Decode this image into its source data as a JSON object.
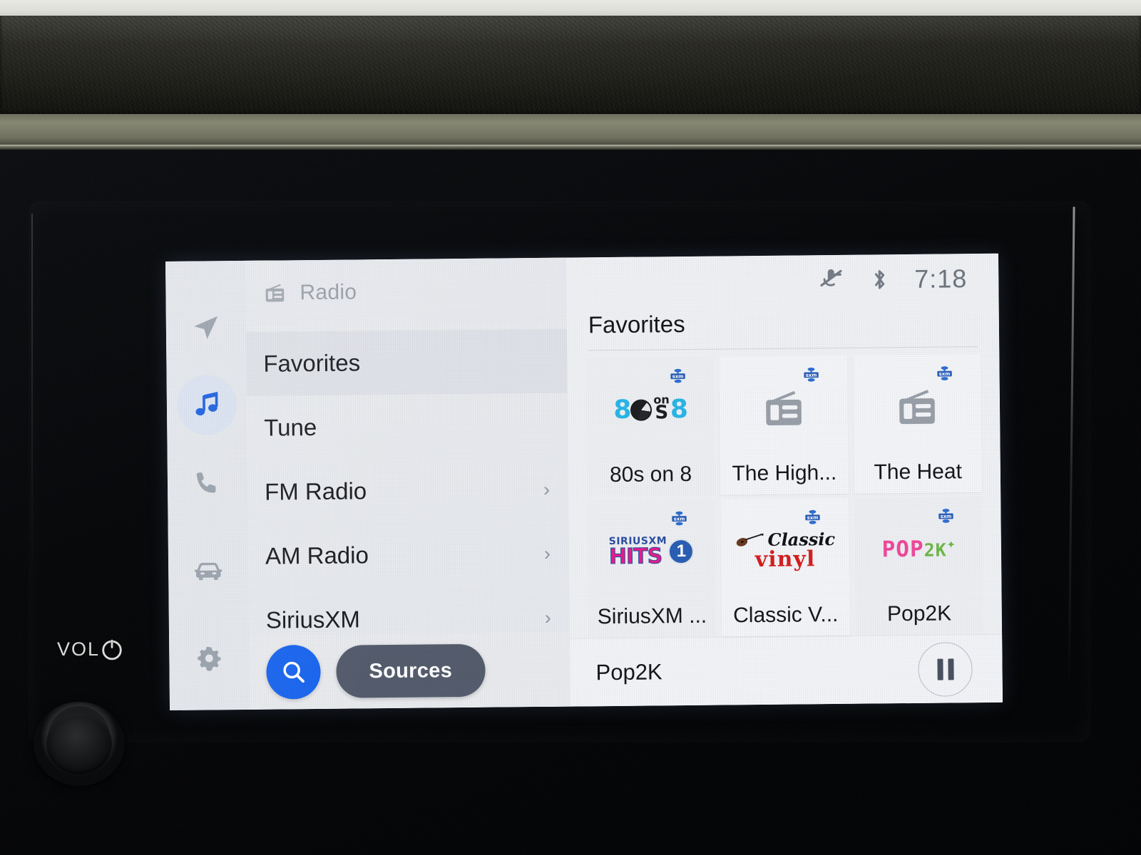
{
  "car_panel": {
    "vol_label": "VOL",
    "power_icon": "power-icon",
    "knob": "volume-knob"
  },
  "rail": {
    "items": [
      {
        "icon": "navigation-arrow-icon",
        "name": "navigation",
        "active": false
      },
      {
        "icon": "music-note-icon",
        "name": "media",
        "active": true
      },
      {
        "icon": "phone-icon",
        "name": "phone",
        "active": false
      },
      {
        "icon": "car-icon",
        "name": "vehicle",
        "active": false
      },
      {
        "icon": "gear-icon",
        "name": "settings",
        "active": false
      }
    ],
    "accent_color": "#1a66f0",
    "active_bg": "#dbe3f2"
  },
  "source_panel": {
    "header_icon": "radio-icon",
    "header_title": "Radio",
    "rows": [
      {
        "label": "Favorites",
        "chevron": "",
        "selected": true
      },
      {
        "label": "Tune",
        "chevron": "",
        "selected": false
      },
      {
        "label": "FM Radio",
        "chevron": "›",
        "selected": false
      },
      {
        "label": "AM Radio",
        "chevron": "›",
        "selected": false
      },
      {
        "label": "SiriusXM",
        "chevron": "›",
        "selected": false
      }
    ],
    "search_icon": "search-icon",
    "sources_label": "Sources"
  },
  "statusbar": {
    "icons": [
      "microphone-muted-icon",
      "bluetooth-icon"
    ],
    "time": "7:18"
  },
  "favorites": {
    "title": "Favorites",
    "tiles": [
      {
        "name": "80s on 8",
        "logo": "logo-80s-on-8",
        "badge": "sxm-badge"
      },
      {
        "name": "The High...",
        "logo": "radio-icon",
        "badge": "sxm-badge"
      },
      {
        "name": "The Heat",
        "logo": "radio-icon",
        "badge": "sxm-badge"
      },
      {
        "name": "SiriusXM ...",
        "logo": "logo-siriusxm-hits-1",
        "badge": "sxm-badge"
      },
      {
        "name": "Classic V...",
        "logo": "logo-classic-vinyl",
        "badge": "sxm-badge"
      },
      {
        "name": "Pop2K",
        "logo": "logo-pop2k",
        "badge": "sxm-badge"
      }
    ]
  },
  "now_playing": {
    "title": "Pop2K",
    "transport_icon": "pause-icon"
  },
  "colors": {
    "accent_blue": "#1a66f0",
    "sources_gray": "#555d6e",
    "screen_bg": "#eceef2",
    "tile_bg": "#f4f5f8"
  }
}
